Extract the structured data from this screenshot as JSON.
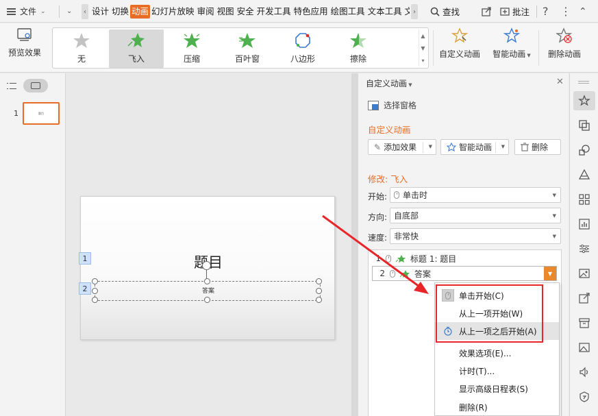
{
  "menubar": {
    "file_label": "文件",
    "tabs": [
      {
        "label": "设计",
        "active": false
      },
      {
        "label": "切换",
        "active": false
      },
      {
        "label": "动画",
        "active": true
      },
      {
        "label": "幻灯片放映",
        "active": false
      },
      {
        "label": "审阅",
        "active": false
      },
      {
        "label": "视图",
        "active": false
      },
      {
        "label": "安全",
        "active": false
      },
      {
        "label": "开发工具",
        "active": false
      },
      {
        "label": "特色应用",
        "active": false
      },
      {
        "label": "绘图工具",
        "active": false
      },
      {
        "label": "文本工具",
        "active": false
      },
      {
        "label": "文",
        "active": false
      }
    ],
    "search_label": "查找",
    "annotate_label": "批注",
    "help_icon": "question-icon",
    "more_icon": "ellipsis-icon",
    "collapse_icon": "chevron-up-icon"
  },
  "ribbon": {
    "preview_label": "预览效果",
    "effects": [
      {
        "label": "无",
        "selected": false,
        "icon": "star-gray"
      },
      {
        "label": "飞入",
        "selected": true,
        "icon": "star-fly-in"
      },
      {
        "label": "压缩",
        "selected": false,
        "icon": "star-compress"
      },
      {
        "label": "百叶窗",
        "selected": false,
        "icon": "star-blinds"
      },
      {
        "label": "八边形",
        "selected": false,
        "icon": "octagon"
      },
      {
        "label": "擦除",
        "selected": false,
        "icon": "star-wipe"
      }
    ],
    "custom_anim_label": "自定义动画",
    "smart_anim_label": "智能动画",
    "delete_anim_label": "删除动画"
  },
  "slides_panel": {
    "slide_number": "1",
    "thumb_text": "题目"
  },
  "slide": {
    "title": "题目",
    "subtitle": "答案",
    "anim_tag_1": "1",
    "anim_tag_2": "2"
  },
  "task_pane": {
    "title": "自定义动画",
    "select_pane_label": "选择窗格",
    "section_label": "自定义动画",
    "add_effect_label": "添加效果",
    "smart_anim_label": "智能动画",
    "delete_label": "删除",
    "modify_label": "修改: 飞入",
    "start_label": "开始:",
    "start_value": "单击时",
    "direction_label": "方向:",
    "direction_value": "自底部",
    "speed_label": "速度:",
    "speed_value": "非常快",
    "anim_items": [
      {
        "num": "1",
        "label": "标题 1: 题目"
      },
      {
        "num": "2",
        "label": "答案"
      }
    ]
  },
  "context_menu": {
    "items": [
      {
        "label": "单击开始(C)",
        "icon": "mouse-click-icon",
        "highlighted": false
      },
      {
        "label": "从上一项开始(W)",
        "icon": "",
        "highlighted": false
      },
      {
        "label": "从上一项之后开始(A)",
        "icon": "clock-icon",
        "highlighted": true
      },
      {
        "label": "效果选项(E)...",
        "icon": "",
        "highlighted": false
      },
      {
        "label": "计时(T)...",
        "icon": "",
        "highlighted": false
      },
      {
        "label": "显示高级日程表(S)",
        "icon": "",
        "highlighted": false
      },
      {
        "label": "删除(R)",
        "icon": "",
        "highlighted": false
      }
    ]
  },
  "colors": {
    "accent": "#e86c25",
    "annotation_red": "#e8262a",
    "selected_tab_bg": "#e86c25"
  }
}
